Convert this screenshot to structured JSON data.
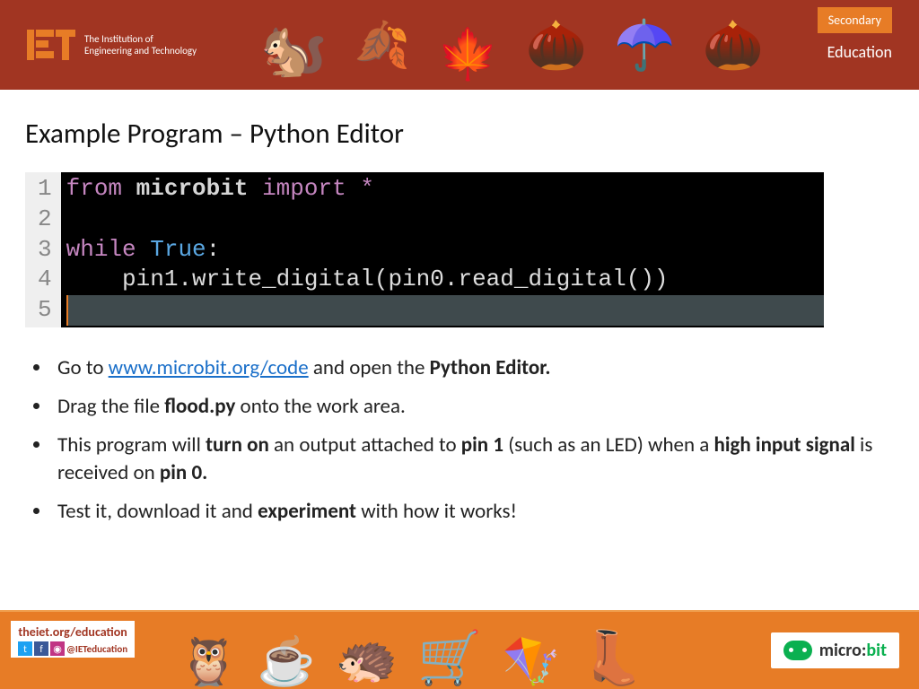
{
  "header": {
    "org_line1": "The Institution of",
    "org_line2": "Engineering and Technology",
    "secondary_badge": "Secondary",
    "education_label": "Education"
  },
  "title": "Example Program – Python Editor",
  "code": {
    "line_numbers": [
      "1",
      "2",
      "3",
      "4",
      "5"
    ],
    "line1_kw_from": "from",
    "line1_mod": "microbit",
    "line1_kw_import": "import",
    "line1_star": "*",
    "line3_kw_while": "while",
    "line3_true": "True",
    "line3_colon": ":",
    "line4": "    pin1.write_digital(pin0.read_digital())"
  },
  "bullets": {
    "b1_pre": "Go to ",
    "b1_link": "www.microbit.org/code",
    "b1_post1": " and open the ",
    "b1_bold": "Python Editor.",
    "b2_pre": "Drag the file ",
    "b2_bold": "flood.py",
    "b2_post": " onto the work area.",
    "b3_pre": "This program will ",
    "b3_bold1": "turn on",
    "b3_mid1": " an output attached to ",
    "b3_bold2": "pin 1",
    "b3_mid2": " (such as an LED) when a ",
    "b3_bold3": "high input signal",
    "b3_mid3": " is received on ",
    "b3_bold4": "pin 0.",
    "b4_pre": "Test it, download it and ",
    "b4_bold": "experiment",
    "b4_post": " with how it works!"
  },
  "footer": {
    "url": "theiet.org/education",
    "handle": "@IETeducation",
    "microbit_micro": "micro:",
    "microbit_bit": "bit"
  }
}
